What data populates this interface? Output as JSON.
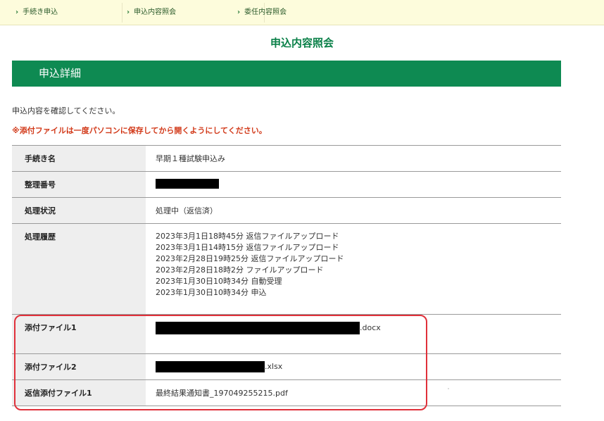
{
  "nav": {
    "items": [
      "手続き申込",
      "申込内容照会",
      "委任内容照会"
    ]
  },
  "page": {
    "title": "申込内容照会",
    "section_title": "申込詳細",
    "instruction": "申込内容を確認してください。",
    "warning": "※添付ファイルは一度パソコンに保存してから開くようにしてください。"
  },
  "details": {
    "procedure_label": "手続き名",
    "procedure_value": "早期１種試験申込み",
    "ref_label": "整理番号",
    "status_label": "処理状況",
    "status_value": "処理中（返信済）",
    "history_label": "処理履歴",
    "history": [
      "2023年3月1日18時45分  返信ファイルアップロード",
      "2023年3月1日14時15分  返信ファイルアップロード",
      "2023年2月28日19時25分  返信ファイルアップロード",
      "2023年2月28日18時2分  ファイルアップロード",
      "2023年1月30日10時34分  自動受理",
      "2023年1月30日10時34分  申込"
    ],
    "attach1_label": "添付ファイル1",
    "attach1_ext": ".docx",
    "attach2_label": "添付ファイル2",
    "attach2_ext": ".xlsx",
    "reply_label": "返信添付ファイル1",
    "reply_value": "最終結果通知書_197049255215.pdf"
  },
  "colors": {
    "brand_green": "#0e8a52",
    "warning_red": "#d23a1a",
    "highlight_red": "#e0303a"
  }
}
